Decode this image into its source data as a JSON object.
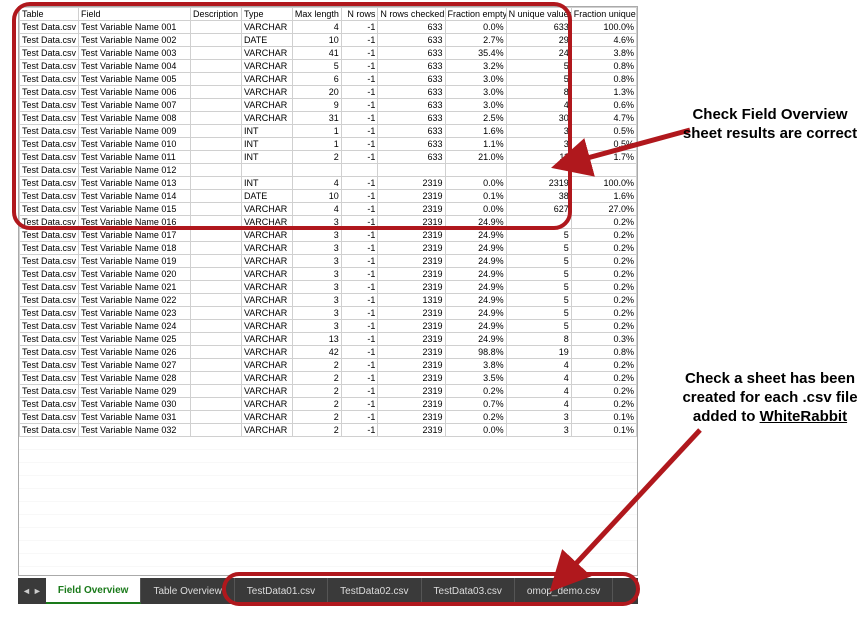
{
  "headers": [
    "Table",
    "Field",
    "Description",
    "Type",
    "Max length",
    "N rows",
    "N rows checked",
    "Fraction empty",
    "N unique values",
    "Fraction unique"
  ],
  "rows": [
    [
      "Test Data.csv",
      "Test Variable Name 001",
      "",
      "VARCHAR",
      "4",
      "-1",
      "633",
      "0.0%",
      "633",
      "100.0%"
    ],
    [
      "Test Data.csv",
      "Test Variable Name 002",
      "",
      "DATE",
      "10",
      "-1",
      "633",
      "2.7%",
      "29",
      "4.6%"
    ],
    [
      "Test Data.csv",
      "Test Variable Name 003",
      "",
      "VARCHAR",
      "41",
      "-1",
      "633",
      "35.4%",
      "24",
      "3.8%"
    ],
    [
      "Test Data.csv",
      "Test Variable Name 004",
      "",
      "VARCHAR",
      "5",
      "-1",
      "633",
      "3.2%",
      "5",
      "0.8%"
    ],
    [
      "Test Data.csv",
      "Test Variable Name 005",
      "",
      "VARCHAR",
      "6",
      "-1",
      "633",
      "3.0%",
      "5",
      "0.8%"
    ],
    [
      "Test Data.csv",
      "Test Variable Name 006",
      "",
      "VARCHAR",
      "20",
      "-1",
      "633",
      "3.0%",
      "8",
      "1.3%"
    ],
    [
      "Test Data.csv",
      "Test Variable Name 007",
      "",
      "VARCHAR",
      "9",
      "-1",
      "633",
      "3.0%",
      "4",
      "0.6%"
    ],
    [
      "Test Data.csv",
      "Test Variable Name 008",
      "",
      "VARCHAR",
      "31",
      "-1",
      "633",
      "2.5%",
      "30",
      "4.7%"
    ],
    [
      "Test Data.csv",
      "Test Variable Name 009",
      "",
      "INT",
      "1",
      "-1",
      "633",
      "1.6%",
      "3",
      "0.5%"
    ],
    [
      "Test Data.csv",
      "Test Variable Name 010",
      "",
      "INT",
      "1",
      "-1",
      "633",
      "1.1%",
      "3",
      "0.5%"
    ],
    [
      "Test Data.csv",
      "Test Variable Name 011",
      "",
      "INT",
      "2",
      "-1",
      "633",
      "21.0%",
      "11",
      "1.7%"
    ],
    [
      "Test Data.csv",
      "Test Variable Name 012",
      "",
      "",
      "",
      "",
      "",
      "",
      "",
      ""
    ],
    [
      "Test Data.csv",
      "Test Variable Name 013",
      "",
      "INT",
      "4",
      "-1",
      "2319",
      "0.0%",
      "2319",
      "100.0%"
    ],
    [
      "Test Data.csv",
      "Test Variable Name 014",
      "",
      "DATE",
      "10",
      "-1",
      "2319",
      "0.1%",
      "38",
      "1.6%"
    ],
    [
      "Test Data.csv",
      "Test Variable Name 015",
      "",
      "VARCHAR",
      "4",
      "-1",
      "2319",
      "0.0%",
      "627",
      "27.0%"
    ],
    [
      "Test Data.csv",
      "Test Variable Name 016",
      "",
      "VARCHAR",
      "3",
      "-1",
      "2319",
      "24.9%",
      "",
      "0.2%"
    ],
    [
      "Test Data.csv",
      "Test Variable Name 017",
      "",
      "VARCHAR",
      "3",
      "-1",
      "2319",
      "24.9%",
      "5",
      "0.2%"
    ],
    [
      "Test Data.csv",
      "Test Variable Name 018",
      "",
      "VARCHAR",
      "3",
      "-1",
      "2319",
      "24.9%",
      "5",
      "0.2%"
    ],
    [
      "Test Data.csv",
      "Test Variable Name 019",
      "",
      "VARCHAR",
      "3",
      "-1",
      "2319",
      "24.9%",
      "5",
      "0.2%"
    ],
    [
      "Test Data.csv",
      "Test Variable Name 020",
      "",
      "VARCHAR",
      "3",
      "-1",
      "2319",
      "24.9%",
      "5",
      "0.2%"
    ],
    [
      "Test Data.csv",
      "Test Variable Name 021",
      "",
      "VARCHAR",
      "3",
      "-1",
      "2319",
      "24.9%",
      "5",
      "0.2%"
    ],
    [
      "Test Data.csv",
      "Test Variable Name 022",
      "",
      "VARCHAR",
      "3",
      "-1",
      "1319",
      "24.9%",
      "5",
      "0.2%"
    ],
    [
      "Test Data.csv",
      "Test Variable Name 023",
      "",
      "VARCHAR",
      "3",
      "-1",
      "2319",
      "24.9%",
      "5",
      "0.2%"
    ],
    [
      "Test Data.csv",
      "Test Variable Name 024",
      "",
      "VARCHAR",
      "3",
      "-1",
      "2319",
      "24.9%",
      "5",
      "0.2%"
    ],
    [
      "Test Data.csv",
      "Test Variable Name 025",
      "",
      "VARCHAR",
      "13",
      "-1",
      "2319",
      "24.9%",
      "8",
      "0.3%"
    ],
    [
      "Test Data.csv",
      "Test Variable Name 026",
      "",
      "VARCHAR",
      "42",
      "-1",
      "2319",
      "98.8%",
      "19",
      "0.8%"
    ],
    [
      "Test Data.csv",
      "Test Variable Name 027",
      "",
      "VARCHAR",
      "2",
      "-1",
      "2319",
      "3.8%",
      "4",
      "0.2%"
    ],
    [
      "Test Data.csv",
      "Test Variable Name 028",
      "",
      "VARCHAR",
      "2",
      "-1",
      "2319",
      "3.5%",
      "4",
      "0.2%"
    ],
    [
      "Test Data.csv",
      "Test Variable Name 029",
      "",
      "VARCHAR",
      "2",
      "-1",
      "2319",
      "0.2%",
      "4",
      "0.2%"
    ],
    [
      "Test Data.csv",
      "Test Variable Name 030",
      "",
      "VARCHAR",
      "2",
      "-1",
      "2319",
      "0.7%",
      "4",
      "0.2%"
    ],
    [
      "Test Data.csv",
      "Test Variable Name 031",
      "",
      "VARCHAR",
      "2",
      "-1",
      "2319",
      "0.2%",
      "3",
      "0.1%"
    ],
    [
      "Test Data.csv",
      "Test Variable Name 032",
      "",
      "VARCHAR",
      "2",
      "-1",
      "2319",
      "0.0%",
      "3",
      "0.1%"
    ]
  ],
  "tabs": [
    "Field Overview",
    "Table Overview",
    "TestData01.csv",
    "TestData02.csv",
    "TestData03.csv",
    "omop_demo.csv"
  ],
  "active_tab": 0,
  "annotations": {
    "top": "Check Field Overview sheet results are correct",
    "bottom_l1": "Check a sheet has been created for each .csv file added to ",
    "bottom_l2": "WhiteRabbit"
  }
}
